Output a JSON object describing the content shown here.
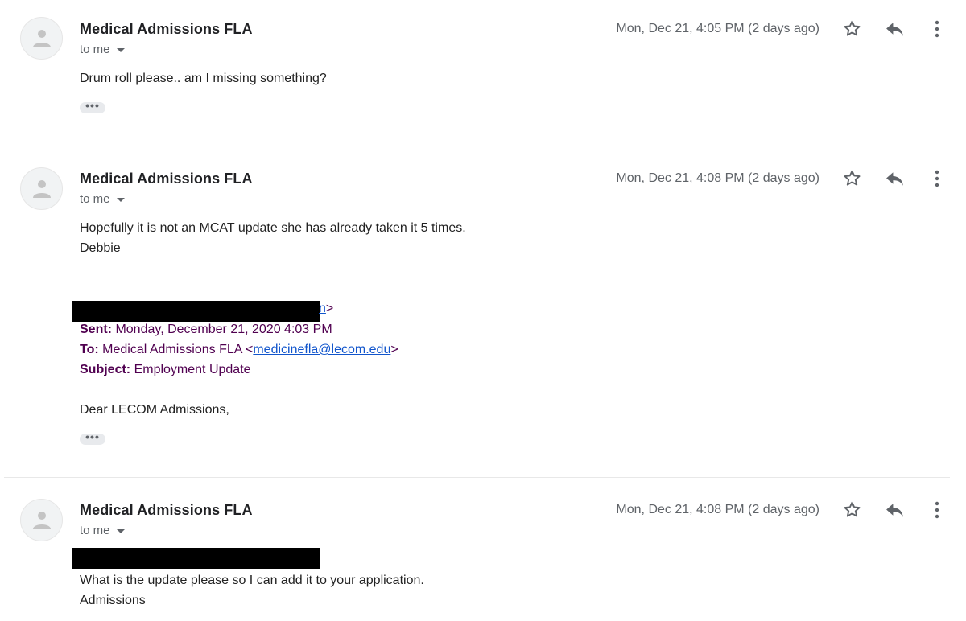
{
  "messages": [
    {
      "sender": "Medical Admissions FLA",
      "recipient": "to me",
      "date": "Mon, Dec 21, 4:05 PM (2 days ago)",
      "body": [
        "Drum roll please.. am I missing something?"
      ]
    },
    {
      "sender": "Medical Admissions FLA",
      "recipient": "to me",
      "date": "Mon, Dec 21, 4:08 PM (2 days ago)",
      "body": [
        "Hopefully it is not an MCAT update she has already taken it 5 times.",
        "Debbie"
      ],
      "quoted": {
        "from_tail": "n",
        "from_close": ">",
        "sent_label": "Sent:",
        "sent_value": "Monday, December 21, 2020 4:03 PM",
        "to_label": "To:",
        "to_name": "Medical Admissions FLA <",
        "to_email": "medicinefla@lecom.edu",
        "to_close": ">",
        "subject_label": "Subject:",
        "subject_value": "Employment Update",
        "greeting": "Dear LECOM Admissions,"
      }
    },
    {
      "sender": "Medical Admissions FLA",
      "recipient": "to me",
      "date": "Mon, Dec 21, 4:08 PM (2 days ago)",
      "body": [
        "What is the update please so I can add it to your application.",
        "Admissions"
      ]
    }
  ],
  "icons": {
    "avatar": "person-icon",
    "star": "star-icon",
    "reply": "reply-icon",
    "more": "more-vert-icon",
    "expand": "ellipsis-icon"
  },
  "colors": {
    "quoted_text": "#500050",
    "link": "#1155cc",
    "secondary": "#5f6368"
  }
}
